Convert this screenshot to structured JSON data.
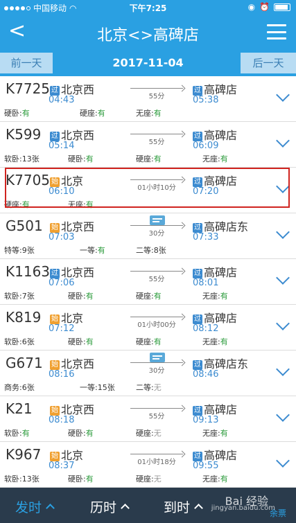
{
  "status": {
    "carrier": "中国移动",
    "time": "下午7:25"
  },
  "nav": {
    "title": "北京<>高碑店"
  },
  "datebar": {
    "prev": "前一天",
    "date": "2017-11-04",
    "next": "后一天"
  },
  "trains": [
    {
      "num": "K7725",
      "type": "pass",
      "type_label": "过",
      "from": "北京西",
      "dep": "04:43",
      "dur": "55分",
      "to_type": "过",
      "to": "高碑店",
      "arr": "05:38",
      "seats": [
        [
          "硬卧:",
          "有",
          "v"
        ],
        [
          "硬座:",
          "有",
          "v"
        ],
        [
          "无座:",
          "有",
          "v"
        ]
      ]
    },
    {
      "num": "K599",
      "type": "pass",
      "type_label": "过",
      "from": "北京西",
      "dep": "05:14",
      "dur": "55分",
      "to_type": "过",
      "to": "高碑店",
      "arr": "06:09",
      "seats": [
        [
          "软卧:",
          "13张",
          "cnt"
        ],
        [
          "硬卧:",
          "有",
          "v"
        ],
        [
          "硬座:",
          "有",
          "v"
        ],
        [
          "无座:",
          "有",
          "v"
        ]
      ]
    },
    {
      "num": "K7705",
      "type": "start",
      "type_label": "始",
      "from": "北京",
      "dep": "06:10",
      "dur": "01小时10分",
      "to_type": "过",
      "to": "高碑店",
      "arr": "07:20",
      "seats": [
        [
          "硬座:",
          "有",
          "v"
        ],
        [
          "无座:",
          "有",
          "v"
        ]
      ]
    },
    {
      "num": "G501",
      "type": "start",
      "type_label": "始",
      "from": "北京西",
      "dep": "07:03",
      "dur": "30分",
      "to_type": "过",
      "to": "高碑店东",
      "arr": "07:33",
      "ticket": true,
      "seats": [
        [
          "特等:",
          "9张",
          "cnt"
        ],
        [
          "一等:",
          "有",
          "v"
        ],
        [
          "二等:",
          "8张",
          "cnt"
        ]
      ]
    },
    {
      "num": "K1163",
      "type": "pass",
      "type_label": "过",
      "from": "北京西",
      "dep": "07:06",
      "dur": "55分",
      "to_type": "过",
      "to": "高碑店",
      "arr": "08:01",
      "seats": [
        [
          "软卧:",
          "7张",
          "cnt"
        ],
        [
          "硬卧:",
          "有",
          "v"
        ],
        [
          "硬座:",
          "有",
          "v"
        ],
        [
          "无座:",
          "有",
          "v"
        ]
      ]
    },
    {
      "num": "K819",
      "type": "start",
      "type_label": "始",
      "from": "北京",
      "dep": "07:12",
      "dur": "01小时00分",
      "to_type": "过",
      "to": "高碑店",
      "arr": "08:12",
      "seats": [
        [
          "软卧:",
          "6张",
          "cnt"
        ],
        [
          "硬卧:",
          "有",
          "v"
        ],
        [
          "硬座:",
          "有",
          "v"
        ],
        [
          "无座:",
          "有",
          "v"
        ]
      ]
    },
    {
      "num": "G671",
      "type": "start",
      "type_label": "始",
      "from": "北京西",
      "dep": "08:16",
      "dur": "30分",
      "to_type": "过",
      "to": "高碑店东",
      "arr": "08:46",
      "ticket": true,
      "seats": [
        [
          "商务:",
          "6张",
          "cnt"
        ],
        [
          "一等:",
          "15张",
          "cnt"
        ],
        [
          "二等:",
          "无",
          "none"
        ]
      ]
    },
    {
      "num": "K21",
      "type": "start",
      "type_label": "始",
      "from": "北京西",
      "dep": "08:18",
      "dur": "55分",
      "to_type": "过",
      "to": "高碑店",
      "arr": "09:13",
      "seats": [
        [
          "软卧:",
          "有",
          "v"
        ],
        [
          "硬卧:",
          "有",
          "v"
        ],
        [
          "硬座:",
          "无",
          "none"
        ],
        [
          "无座:",
          "有",
          "v"
        ]
      ]
    },
    {
      "num": "K967",
      "type": "start",
      "type_label": "始",
      "from": "北京",
      "dep": "08:37",
      "dur": "01小时18分",
      "to_type": "过",
      "to": "高碑店",
      "arr": "09:55",
      "seats": [
        [
          "软卧:",
          "13张",
          "cnt"
        ],
        [
          "硬卧:",
          "有",
          "v"
        ],
        [
          "硬座:",
          "无",
          "none"
        ],
        [
          "无座:",
          "有",
          "v"
        ]
      ]
    }
  ],
  "bottom": {
    "depart": "发时",
    "duration": "历时",
    "arrive": "到时",
    "extra": "余票"
  },
  "watermark": {
    "text": "Bai 经验",
    "url": "jingyan.baidu.com"
  }
}
